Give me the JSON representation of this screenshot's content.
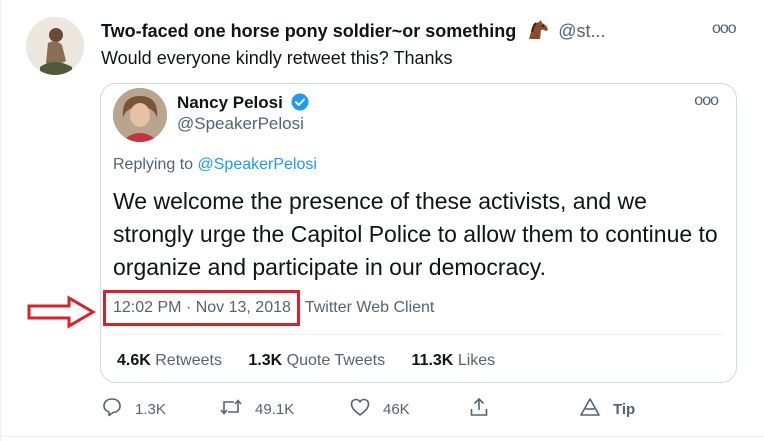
{
  "tweet": {
    "display_name": "Two-faced one horse pony soldier~or something",
    "handle": "@st...",
    "text": "Would everyone kindly retweet this? Thanks",
    "more_label": "ooo"
  },
  "quoted": {
    "name": "Nancy Pelosi",
    "handle": "@SpeakerPelosi",
    "replying_prefix": "Replying to ",
    "replying_to": "@SpeakerPelosi",
    "body": "We welcome the presence of these activists, and we strongly urge the Capitol Police to allow them to continue to organize and participate in our democracy.",
    "time": "12:02 PM",
    "separator": "·",
    "date": "Nov 13, 2018",
    "client": "Twitter Web Client",
    "more_label": "ooo",
    "stats": [
      {
        "count": "4.6K",
        "label": "Retweets"
      },
      {
        "count": "1.3K",
        "label": "Quote Tweets"
      },
      {
        "count": "11.3K",
        "label": "Likes"
      }
    ]
  },
  "actions": {
    "reply_count": "1.3K",
    "retweet_count": "49.1K",
    "like_count": "46K",
    "tip_label": "Tip"
  },
  "colors": {
    "accent": "#1d9bf0",
    "annotation": "#d9232a"
  }
}
